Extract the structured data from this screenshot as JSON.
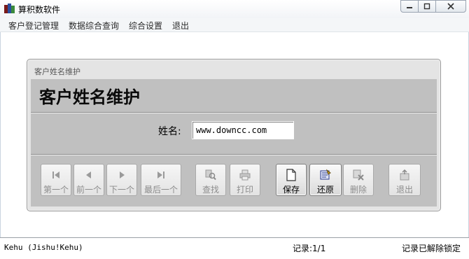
{
  "window": {
    "title": "算积数软件",
    "buttons": {
      "minimize": "—",
      "maximize": "□",
      "close": "✕"
    }
  },
  "menu": [
    {
      "label": "客户登记管理"
    },
    {
      "label": "数据综合查询"
    },
    {
      "label": "综合设置"
    },
    {
      "label": "退出"
    }
  ],
  "form": {
    "caption": "客户姓名维护",
    "heading": "客户姓名维护",
    "name_label": "姓名:",
    "name_value": "www.downcc.com"
  },
  "toolbar": [
    {
      "id": "first",
      "label": "第一个",
      "icon": "first-record-icon",
      "enabled": false
    },
    {
      "id": "prev",
      "label": "前一个",
      "icon": "previous-record-icon",
      "enabled": false
    },
    {
      "id": "next",
      "label": "下一个",
      "icon": "next-record-icon",
      "enabled": false
    },
    {
      "id": "last",
      "label": "最后一个",
      "icon": "last-record-icon",
      "enabled": false
    },
    {
      "id": "find",
      "label": "查找",
      "icon": "find-icon",
      "enabled": false
    },
    {
      "id": "print",
      "label": "打印",
      "icon": "printer-icon",
      "enabled": false
    },
    {
      "id": "save",
      "label": "保存",
      "icon": "document-icon",
      "enabled": true
    },
    {
      "id": "restore",
      "label": "还原",
      "icon": "restore-icon",
      "enabled": true
    },
    {
      "id": "delete",
      "label": "删除",
      "icon": "delete-icon",
      "enabled": false
    },
    {
      "id": "exit",
      "label": "退出",
      "icon": "exit-icon",
      "enabled": false
    }
  ],
  "status": {
    "user": "Kehu (Jishu!Kehu)",
    "record": "记录:1/1",
    "lock": "记录已解除锁定"
  }
}
